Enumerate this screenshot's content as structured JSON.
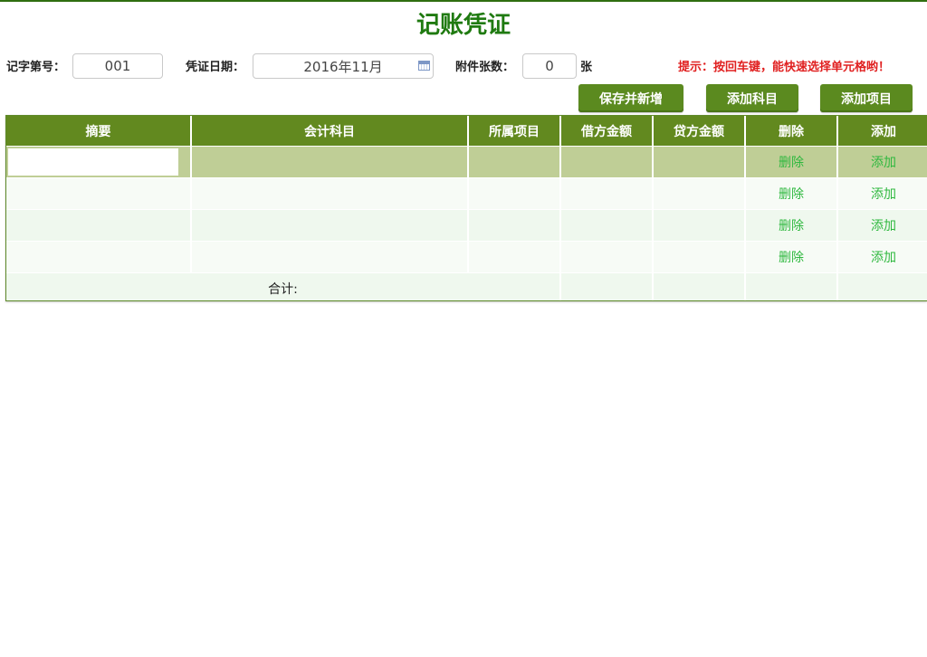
{
  "page": {
    "title": "记账凭证"
  },
  "form": {
    "voucher_no_label": "记字第号：",
    "voucher_no_value": "001",
    "date_label": "凭证日期：",
    "date_value": "2016年11月",
    "attachments_label": "附件张数：",
    "attachments_value": "0",
    "attachments_unit": "张",
    "hint": "提示：按回车键，能快速选择单元格哟！"
  },
  "toolbar": {
    "save_new_label": "保存并新增",
    "add_subject_label": "添加科目",
    "add_project_label": "添加项目"
  },
  "table": {
    "headers": [
      "摘要",
      "会计科目",
      "所属项目",
      "借方金额",
      "贷方金额",
      "删除",
      "添加"
    ],
    "delete_label": "删除",
    "add_label": "添加",
    "total_label": "合计:"
  },
  "colors": {
    "title": "#1f7a10",
    "header_bg": "#62891f",
    "button_bg": "#5b8a1f",
    "hint": "#e02020",
    "link": "#2fb83f"
  }
}
